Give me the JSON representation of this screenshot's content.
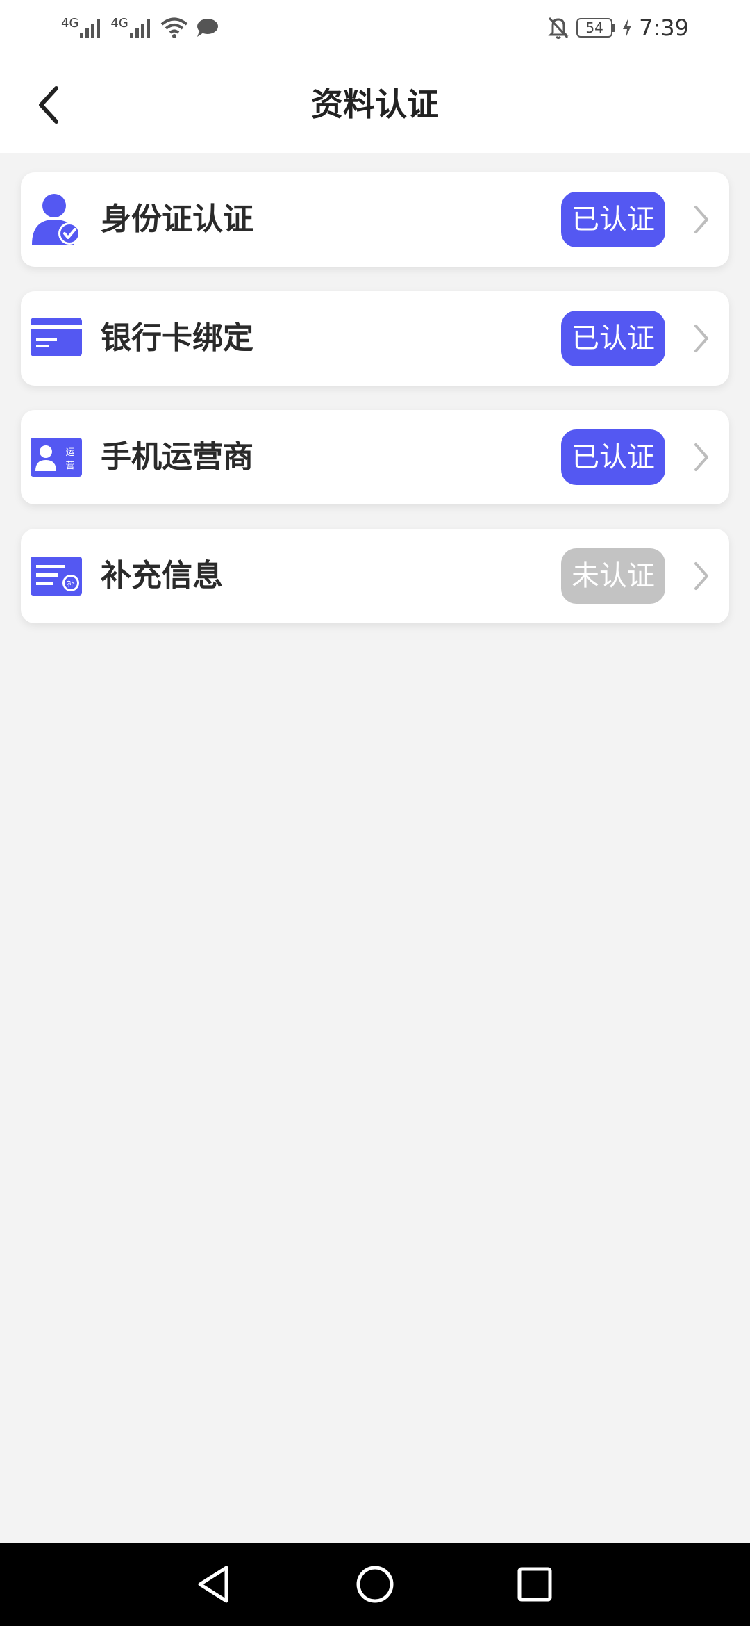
{
  "status_bar": {
    "network_1": "4G",
    "network_2": "4G",
    "battery": "54",
    "time": "7:39",
    "icons": [
      "signal-icon",
      "signal-icon",
      "wifi-icon",
      "message-icon",
      "bell-off-icon",
      "battery-icon",
      "charging-icon"
    ]
  },
  "header": {
    "title": "资料认证",
    "back_icon": "chevron-left-icon"
  },
  "items": [
    {
      "label": "身份证认证",
      "status": "已认证",
      "verified": true,
      "icon": "id-person-icon"
    },
    {
      "label": "银行卡绑定",
      "status": "已认证",
      "verified": true,
      "icon": "bank-card-icon"
    },
    {
      "label": "手机运营商",
      "status": "已认证",
      "verified": true,
      "icon": "carrier-card-icon",
      "icon_text_1": "运",
      "icon_text_2": "营"
    },
    {
      "label": "补充信息",
      "status": "未认证",
      "verified": false,
      "icon": "supplement-info-icon",
      "icon_text": "补"
    }
  ],
  "colors": {
    "accent": "#5458f2",
    "pending": "#c3c3c3",
    "background": "#f3f3f3",
    "card": "#ffffff"
  },
  "nav": {
    "icons": [
      "nav-back-icon",
      "nav-home-icon",
      "nav-recents-icon"
    ]
  }
}
